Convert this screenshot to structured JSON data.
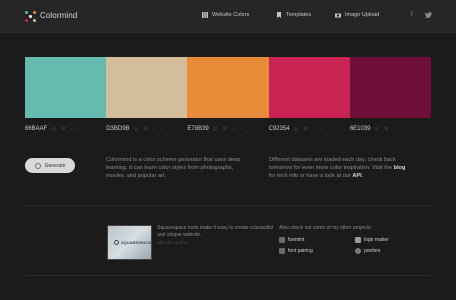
{
  "header": {
    "brand": "Colormind",
    "nav": [
      {
        "label": "Website Colors",
        "icon": "grid-icon"
      },
      {
        "label": "Templates",
        "icon": "bookmark-icon"
      },
      {
        "label": "Image Upload",
        "icon": "camera-icon"
      }
    ],
    "social": [
      {
        "label": "f",
        "icon": "facebook-icon"
      },
      {
        "label": "🐦",
        "icon": "twitter-icon"
      }
    ],
    "logo_colors": [
      "#5ec1b5",
      "#e8913a",
      "#c92354",
      "#d3bd9b"
    ]
  },
  "palette": {
    "colors": [
      {
        "hex": "#66BAAF",
        "code": "66BAAF"
      },
      {
        "hex": "#D3BD9B",
        "code": "D3BD9B"
      },
      {
        "hex": "#E78B39",
        "code": "E78B39"
      },
      {
        "hex": "#C92354",
        "code": "C92354"
      },
      {
        "hex": "#6E1039",
        "code": "6E1039"
      }
    ],
    "mini_controls": "◎ ⚙ ‹ ›"
  },
  "actions": {
    "generate_label": "Generate"
  },
  "description": {
    "left": "Colormind is a color scheme generator that uses deep learning. It can learn color styles from photographs, movies, and popular art.",
    "right_pre": "Different datasets are loaded each day, check back tomorrow for even more color inspiration. Visit the",
    "right_blog": "blog",
    "right_mid": "for tech info or have a look at our",
    "right_api": "API"
  },
  "ad": {
    "image_label": "SQUARESPACE",
    "text": "Squarespace tools make it easy to create a beautiful and unique website.",
    "via": "ads via Carbon"
  },
  "other_projects": {
    "title": "Also check out some of my other projects:",
    "items": [
      "fuemint",
      "logo maker",
      "font pairing",
      "poolors"
    ]
  }
}
